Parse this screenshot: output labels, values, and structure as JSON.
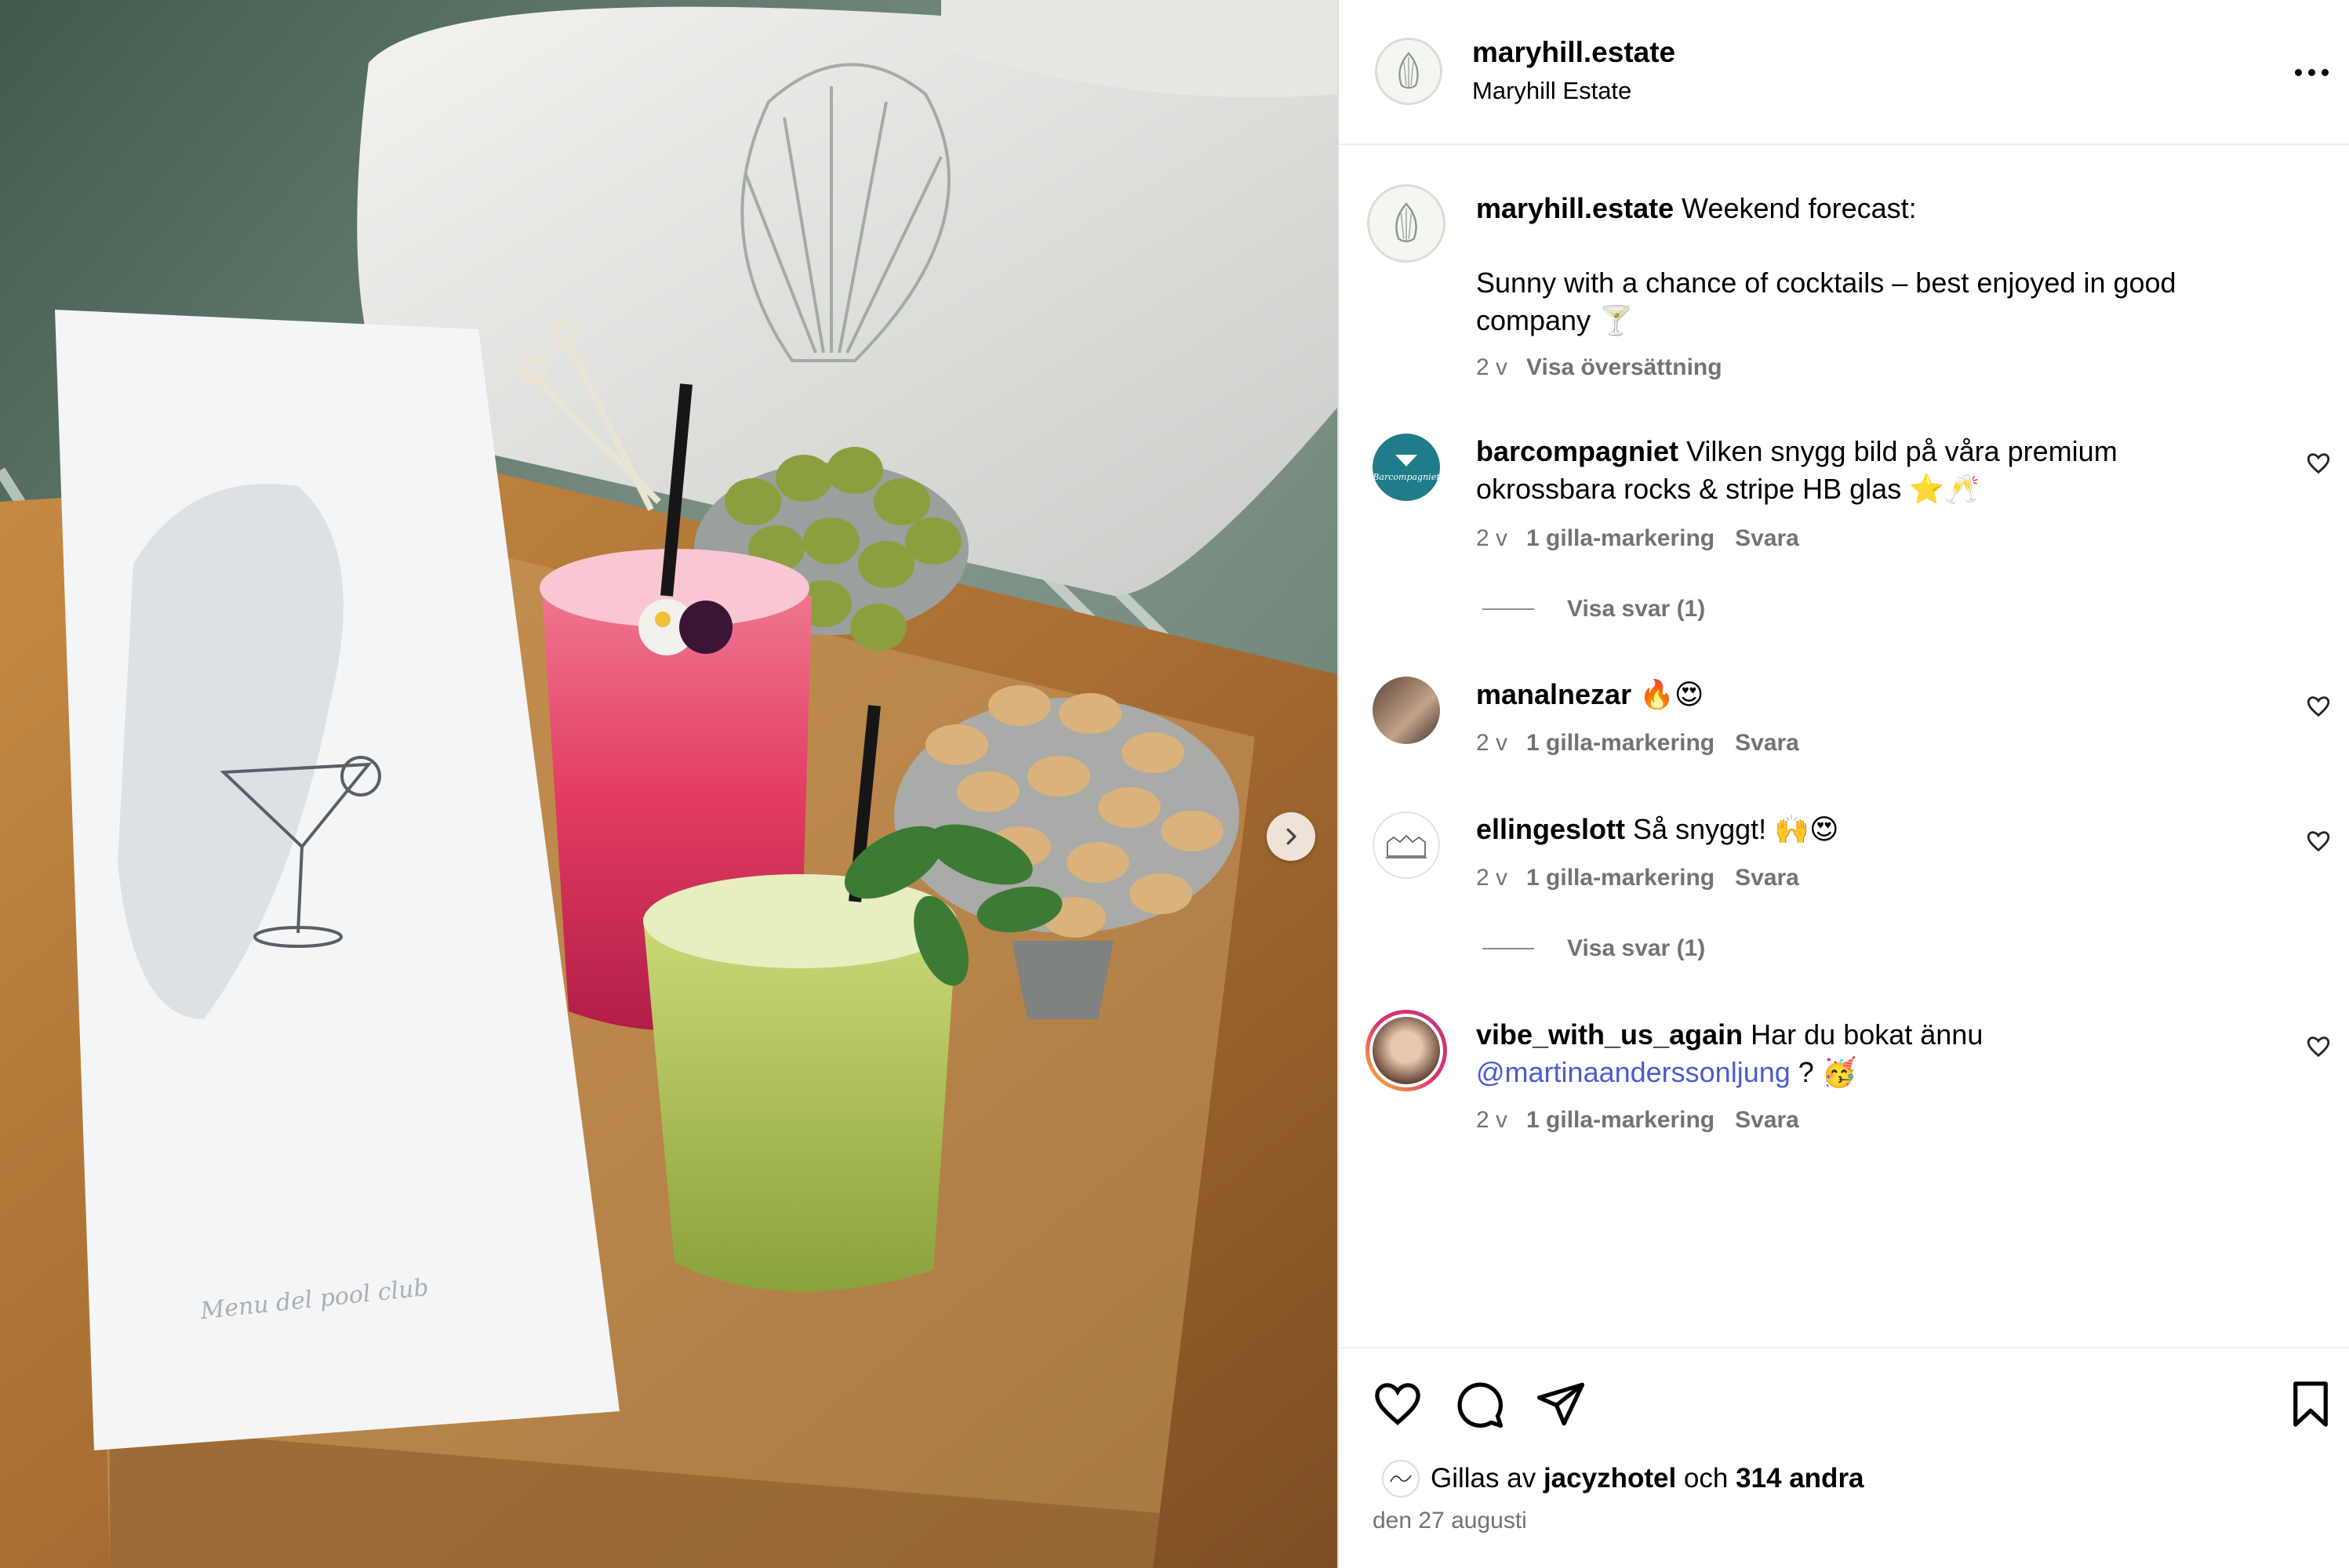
{
  "post": {
    "username": "maryhill.estate",
    "location": "Maryhill Estate",
    "caption_user": "maryhill.estate",
    "caption_line1": "Weekend forecast:",
    "caption_line2": "Sunny with a chance of cocktails – best enjoyed in good company 🍸",
    "caption_time": "2 v",
    "translate_label": "Visa översättning",
    "menu_text": "Menu del pool club"
  },
  "comments": [
    {
      "user": "barcompagniet",
      "text": "Vilken snygg bild på våra premium okrossbara rocks & stripe HB glas ⭐️🥂",
      "time": "2 v",
      "likes": "1 gilla-markering",
      "reply": "Svara",
      "view_replies": "Visa svar (1)",
      "avatar_label": "Barcompagniet"
    },
    {
      "user": "manalnezar",
      "text": "🔥😍",
      "time": "2 v",
      "likes": "1 gilla-markering",
      "reply": "Svara"
    },
    {
      "user": "ellingeslott",
      "text": "Så snyggt! 🙌😍",
      "time": "2 v",
      "likes": "1 gilla-markering",
      "reply": "Svara",
      "view_replies": "Visa svar (1)"
    },
    {
      "user": "vibe_with_us_again",
      "text": "Har du bokat ännu",
      "mention": "@martinaanderssonljung",
      "text_after": " ? 🥳",
      "time": "2 v",
      "likes": "1 gilla-markering",
      "reply": "Svara"
    }
  ],
  "footer": {
    "liked_prefix": "Gillas av",
    "liked_user": "jacyzhotel",
    "liked_join": "och",
    "liked_others": "314 andra",
    "date": "den 27 augusti"
  },
  "icons": [
    "estate-logo-icon",
    "more-options-icon",
    "next-arrow-icon",
    "heart-icon",
    "comment-icon",
    "share-icon",
    "bookmark-icon"
  ],
  "colors": {
    "mention": "#4b5bd1",
    "meta": "#737373",
    "divider": "#efefef"
  }
}
